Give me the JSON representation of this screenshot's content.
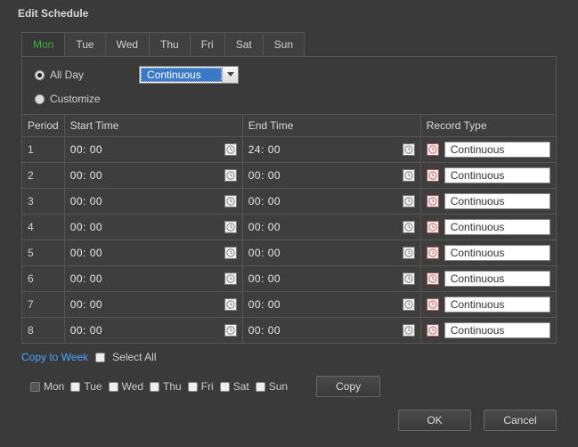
{
  "title": "Edit Schedule",
  "tabs": [
    "Mon",
    "Tue",
    "Wed",
    "Thu",
    "Fri",
    "Sat",
    "Sun"
  ],
  "active_tab_index": 0,
  "mode": {
    "all_day_label": "All Day",
    "customize_label": "Customize",
    "selected": "all_day",
    "continuous_select": "Continuous"
  },
  "columns": {
    "period": "Period",
    "start": "Start Time",
    "end": "End Time",
    "record": "Record Type"
  },
  "rows": [
    {
      "period": "1",
      "start": "00: 00",
      "end": "24: 00",
      "record": "Continuous"
    },
    {
      "period": "2",
      "start": "00: 00",
      "end": "00: 00",
      "record": "Continuous"
    },
    {
      "period": "3",
      "start": "00: 00",
      "end": "00: 00",
      "record": "Continuous"
    },
    {
      "period": "4",
      "start": "00: 00",
      "end": "00: 00",
      "record": "Continuous"
    },
    {
      "period": "5",
      "start": "00: 00",
      "end": "00: 00",
      "record": "Continuous"
    },
    {
      "period": "6",
      "start": "00: 00",
      "end": "00: 00",
      "record": "Continuous"
    },
    {
      "period": "7",
      "start": "00: 00",
      "end": "00: 00",
      "record": "Continuous"
    },
    {
      "period": "8",
      "start": "00: 00",
      "end": "00: 00",
      "record": "Continuous"
    }
  ],
  "copy": {
    "link": "Copy to Week",
    "select_all": "Select All",
    "days": [
      "Mon",
      "Tue",
      "Wed",
      "Thu",
      "Fri",
      "Sat",
      "Sun"
    ],
    "button": "Copy"
  },
  "footer": {
    "ok": "OK",
    "cancel": "Cancel"
  }
}
